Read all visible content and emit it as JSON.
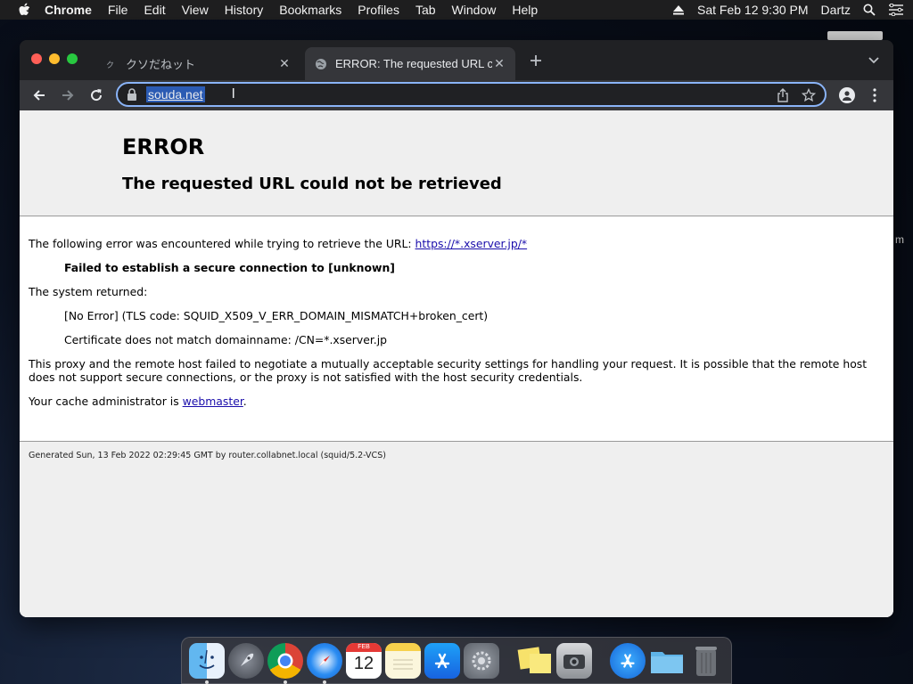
{
  "menubar": {
    "app": "Chrome",
    "items": [
      "File",
      "Edit",
      "View",
      "History",
      "Bookmarks",
      "Profiles",
      "Tab",
      "Window",
      "Help"
    ],
    "datetime": "Sat Feb 12  9:30 PM",
    "user": "Dartz"
  },
  "tabs": [
    {
      "title": "クソだねット",
      "favicon": "kuso-favicon",
      "active": false
    },
    {
      "title": "ERROR: The requested URL co",
      "favicon": "globe-icon",
      "active": true
    }
  ],
  "omnibox": {
    "url": "souda.net"
  },
  "page": {
    "heading": "ERROR",
    "subheading": "The requested URL could not be retrieved",
    "intro": "The following error was encountered while trying to retrieve the URL: ",
    "intro_link": "https://*.xserver.jp/*",
    "failure": "Failed to establish a secure connection to [unknown]",
    "system_returned": "The system returned:",
    "tls_error": "[No Error] (TLS code: SQUID_X509_V_ERR_DOMAIN_MISMATCH+broken_cert)",
    "cert_error": "Certificate does not match domainname: /CN=*.xserver.jp",
    "explanation": "This proxy and the remote host failed to negotiate a mutually acceptable security settings for handling your request. It is possible that the remote host does not support secure connections, or the proxy is not satisfied with the host security credentials.",
    "admin_prefix": "Your cache administrator is ",
    "admin_link": "webmaster",
    "admin_suffix": ".",
    "footer": "Generated Sun, 13 Feb 2022 02:29:45 GMT by router.collabnet.local (squid/5.2-VCS)"
  },
  "desktop": {
    "side_text": "m"
  },
  "dock": {
    "apps": [
      "finder",
      "launchpad",
      "chrome",
      "safari",
      "calendar",
      "notes",
      "app-store",
      "system-preferences",
      "stickies",
      "screenshot",
      "app-store-folder",
      "folder",
      "trash"
    ],
    "calendar_month": "FEB",
    "calendar_day": "12"
  },
  "colors": {
    "accent": "#8ab4f8",
    "link": "#1a0dab",
    "url_highlight": "#2b5bb3"
  }
}
